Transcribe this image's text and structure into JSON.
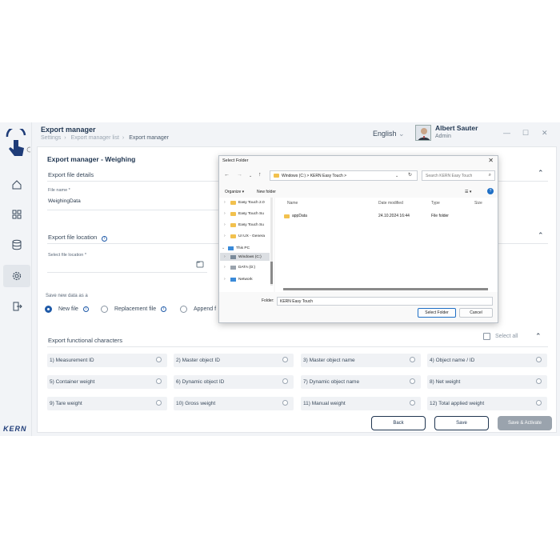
{
  "header": {
    "title": "Export manager",
    "breadcrumbs": [
      "Settings",
      "Export manager list",
      "Export manager"
    ],
    "language": "English",
    "user_name": "Albert Sauter",
    "user_role": "Admin"
  },
  "brand": "KERN",
  "page": {
    "heading": "Export manager - Weighing",
    "file_details": {
      "title": "Export file details",
      "file_name_label": "File name *",
      "file_name_value": "WeighingData"
    },
    "file_location": {
      "title": "Export file location",
      "select_label": "Select file location *"
    },
    "save_as": {
      "label": "Save new data as a",
      "options": [
        "New file",
        "Replacement file",
        "Append f"
      ],
      "selected": "New file"
    },
    "functional": {
      "title": "Export functional characters",
      "select_all": "Select all",
      "items": [
        "1)  Measurement ID",
        "2)  Master object ID",
        "3)  Master object name",
        "4)  Object name / ID",
        "5)  Container weight",
        "6)  Dynamic object ID",
        "7)  Dynamic object name",
        "8)  Net weight",
        "9)  Tare weight",
        "10)  Gross weight",
        "11)  Manual weight",
        "12)  Total applied weight"
      ]
    },
    "buttons": {
      "back": "Back",
      "save": "Save",
      "save_activate": "Save & Activate"
    }
  },
  "dialog": {
    "title": "Select Folder",
    "address": "Windows (C:)  >  KERN Easy Touch  >",
    "search_placeholder": "Search KERN Easy Touch",
    "organize": "Organize ▾",
    "new_folder": "New folder",
    "tree": [
      {
        "label": "Easy Touch 2.0",
        "type": "folder"
      },
      {
        "label": "Easy Touch Su",
        "type": "folder"
      },
      {
        "label": "Easy Touch Su",
        "type": "folder"
      },
      {
        "label": "UI UX - Genera",
        "type": "folder"
      },
      {
        "label": "This PC",
        "type": "pc"
      },
      {
        "label": "Windows (C:)",
        "type": "drive"
      },
      {
        "label": "DATA (D:)",
        "type": "drive"
      },
      {
        "label": "Network",
        "type": "network"
      }
    ],
    "columns": [
      "Name",
      "Date modified",
      "Type",
      "Size"
    ],
    "files": [
      {
        "name": "appData",
        "date": "24.10.2024 16:44",
        "type": "File folder"
      }
    ],
    "folder_label": "Folder:",
    "folder_value": "KERN Easy Touch",
    "select_button": "Select Folder",
    "cancel_button": "Cancel"
  }
}
